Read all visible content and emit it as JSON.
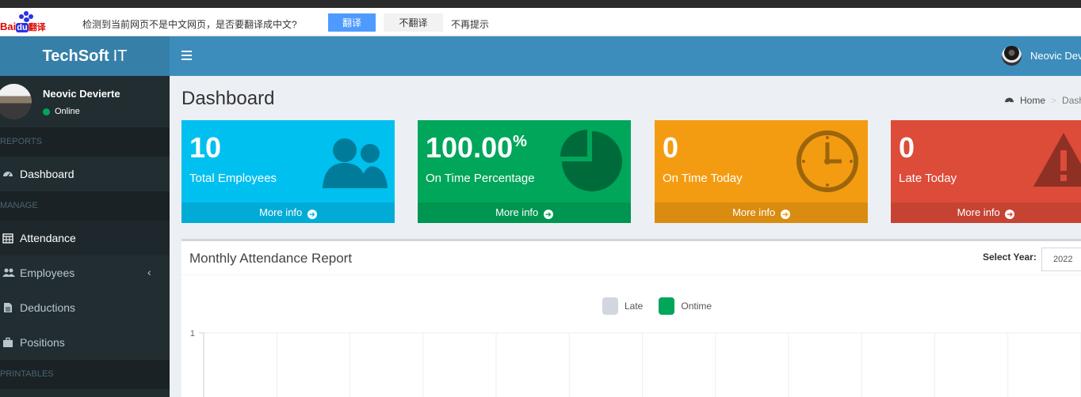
{
  "translate_bar": {
    "brand_bai": "Bai",
    "brand_du": "du",
    "brand_fy": "翻译",
    "message": "检测到当前网页不是中文网页，是否要翻译成中文?",
    "translate_label": "翻译",
    "no_translate_label": "不翻译",
    "no_more_label": "不再提示"
  },
  "header": {
    "logo_bold": "TechSoft",
    "logo_light": "IT",
    "user_name": "Neovic Devierte"
  },
  "sidebar": {
    "user_name": "Neovic Devierte",
    "status": "Online",
    "sections": [
      {
        "header": "REPORTS",
        "items": [
          {
            "label": "Dashboard",
            "icon": "dashboard-icon"
          }
        ]
      },
      {
        "header": "MANAGE",
        "items": [
          {
            "label": "Attendance",
            "icon": "calendar-icon"
          },
          {
            "label": "Employees",
            "icon": "users-icon"
          },
          {
            "label": "Deductions",
            "icon": "file-icon"
          },
          {
            "label": "Positions",
            "icon": "briefcase-icon"
          }
        ]
      },
      {
        "header": "PRINTABLES",
        "items": []
      }
    ]
  },
  "content": {
    "title": "Dashboard",
    "breadcrumb_home": "Home",
    "breadcrumb_current": "Dashb"
  },
  "boxes": [
    {
      "value": "10",
      "suffix": "",
      "label": "Total Employees",
      "footer": "More info",
      "color": "#00c0ef",
      "icon": "users-icon"
    },
    {
      "value": "100.00",
      "suffix": "%",
      "label": "On Time Percentage",
      "footer": "More info",
      "color": "#00a65a",
      "icon": "pie-chart-icon"
    },
    {
      "value": "0",
      "suffix": "",
      "label": "On Time Today",
      "footer": "More info",
      "color": "#f39c12",
      "icon": "clock-icon"
    },
    {
      "value": "0",
      "suffix": "",
      "label": "Late Today",
      "footer": "More info",
      "color": "#dd4b39",
      "icon": "warning-icon"
    }
  ],
  "report": {
    "title": "Monthly Attendance Report",
    "select_year_label": "Select Year:",
    "selected_year": "2022"
  },
  "chart_data": {
    "type": "bar",
    "series": [
      {
        "name": "Late",
        "color": "#d2d6de",
        "values": []
      },
      {
        "name": "Ontime",
        "color": "#00a65a",
        "values": []
      }
    ],
    "yticks": [
      "1"
    ],
    "grid": true,
    "legend_position": "top-center"
  }
}
